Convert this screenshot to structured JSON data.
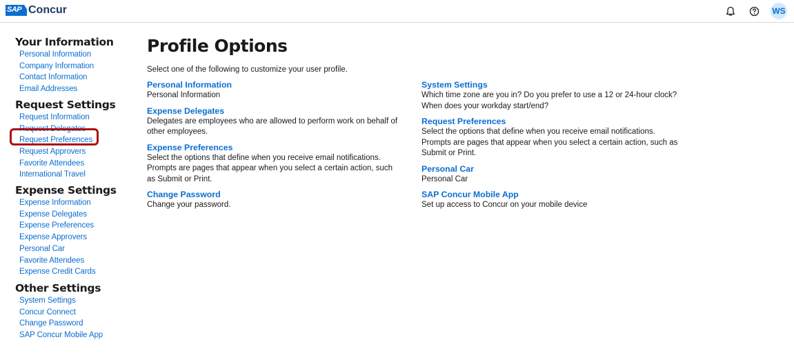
{
  "header": {
    "logo_badge": "SAP",
    "logo_text": "Concur",
    "avatar_initials": "WS",
    "icons": [
      "bell-icon",
      "help-icon"
    ]
  },
  "sidebar": {
    "sections": [
      {
        "heading": "Your Information",
        "items": [
          "Personal Information",
          "Company Information",
          "Contact Information",
          "Email Addresses"
        ]
      },
      {
        "heading": "Request Settings",
        "items": [
          "Request Information",
          "Request Delegates",
          "Request Preferences",
          "Request Approvers",
          "Favorite Attendees",
          "International Travel"
        ]
      },
      {
        "heading": "Expense Settings",
        "items": [
          "Expense Information",
          "Expense Delegates",
          "Expense Preferences",
          "Expense Approvers",
          "Personal Car",
          "Favorite Attendees",
          "Expense Credit Cards"
        ]
      },
      {
        "heading": "Other Settings",
        "items": [
          "System Settings",
          "Concur Connect",
          "Change Password",
          "SAP Concur Mobile App"
        ]
      }
    ],
    "highlighted_item": "Request Delegates",
    "highlight_color": "#a90d10"
  },
  "main": {
    "title": "Profile Options",
    "intro": "Select one of the following to customize your user profile.",
    "left_options": [
      {
        "title": "Personal Information",
        "desc": "Personal Information"
      },
      {
        "title": "Expense Delegates",
        "desc": "Delegates are employees who are allowed to perform work on behalf of other employees."
      },
      {
        "title": "Expense Preferences",
        "desc": "Select the options that define when you receive email notifications. Prompts are pages that appear when you select a certain action, such as Submit or Print."
      },
      {
        "title": "Change Password",
        "desc": "Change your password."
      }
    ],
    "right_options": [
      {
        "title": "System Settings",
        "desc": "Which time zone are you in? Do you prefer to use a 12 or 24-hour clock? When does your workday start/end?"
      },
      {
        "title": "Request Preferences",
        "desc": "Select the options that define when you receive email notifications. Prompts are pages that appear when you select a certain action, such as Submit or Print."
      },
      {
        "title": "Personal Car",
        "desc": "Personal Car"
      },
      {
        "title": "SAP Concur Mobile App",
        "desc": "Set up access to Concur on your mobile device"
      }
    ]
  },
  "colors": {
    "link": "#0a6ed1",
    "brand_dark": "#1b3a63",
    "text": "#1a1a1a"
  }
}
